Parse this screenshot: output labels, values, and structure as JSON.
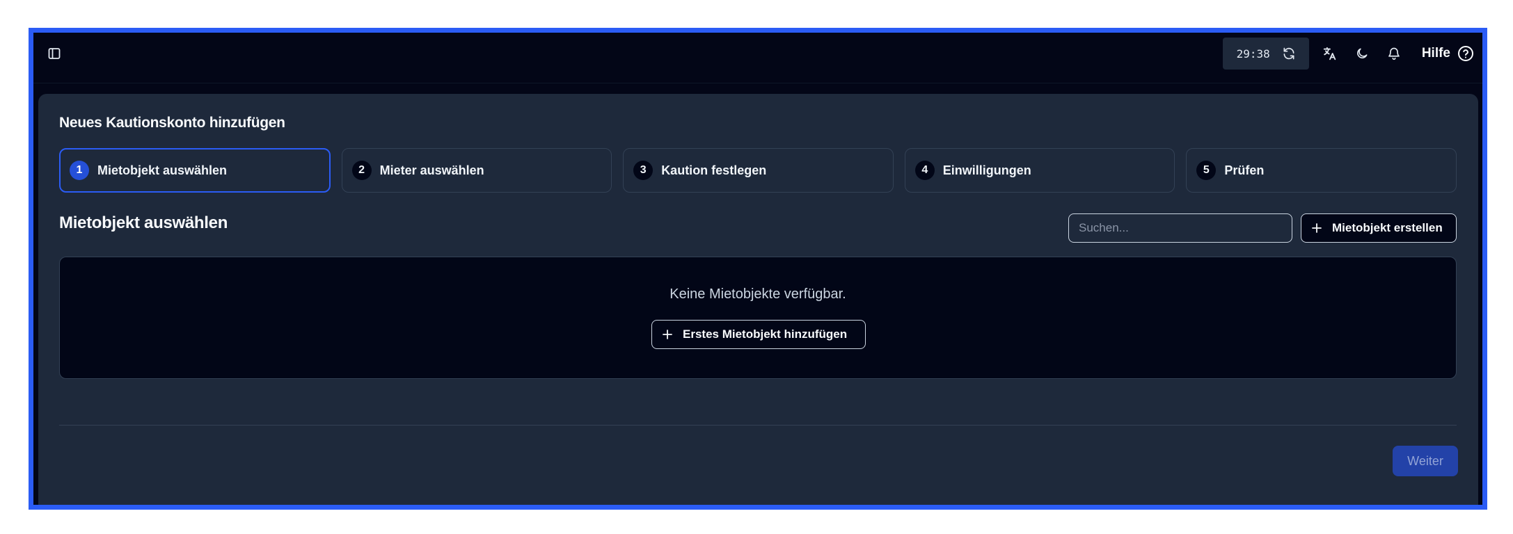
{
  "topbar": {
    "sidebar_toggle_icon": "sidebar-panel-icon",
    "timer": "29:38",
    "refresh_icon": "refresh-icon",
    "translate_icon": "translate-icon",
    "theme_icon": "moon-icon",
    "notifications_icon": "bell-icon",
    "help_label": "Hilfe",
    "help_icon": "question-circle-icon"
  },
  "card": {
    "title": "Neues Kautionskonto hinzufügen",
    "steps": [
      {
        "number": "1",
        "label": "Mietobjekt auswählen",
        "active": true
      },
      {
        "number": "2",
        "label": "Mieter auswählen",
        "active": false
      },
      {
        "number": "3",
        "label": "Kaution festlegen",
        "active": false
      },
      {
        "number": "4",
        "label": "Einwilligungen",
        "active": false
      },
      {
        "number": "5",
        "label": "Prüfen",
        "active": false
      }
    ],
    "section_title": "Mietobjekt auswählen",
    "search": {
      "placeholder": "Suchen...",
      "value": ""
    },
    "create_button": "Mietobjekt erstellen",
    "empty_state": {
      "text": "Keine Mietobjekte verfügbar.",
      "button": "Erstes Mietobjekt hinzufügen"
    },
    "next_button": "Weiter"
  },
  "colors": {
    "accent": "#2b5cf5",
    "background": "#030617",
    "card": "#1e293b",
    "border": "#334155",
    "next_disabled": "#2342a8"
  }
}
